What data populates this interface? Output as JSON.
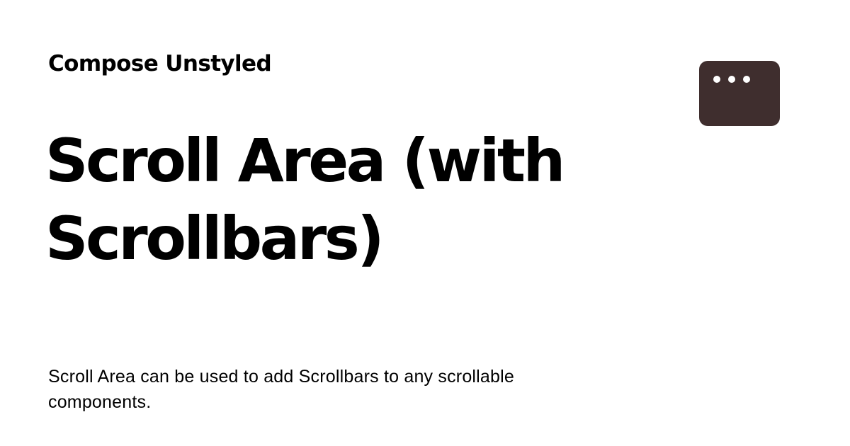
{
  "brand": {
    "name": "Compose Unstyled"
  },
  "page": {
    "title": "Scroll Area (with Scrollbars)",
    "description": "Scroll Area can be used to add Scrollbars to any scrollable components."
  },
  "icons": {
    "window": "window-icon"
  },
  "colors": {
    "background": "#ffffff",
    "text": "#000000",
    "window_icon": "#3f2e2e",
    "window_dots": "#ffffff"
  }
}
